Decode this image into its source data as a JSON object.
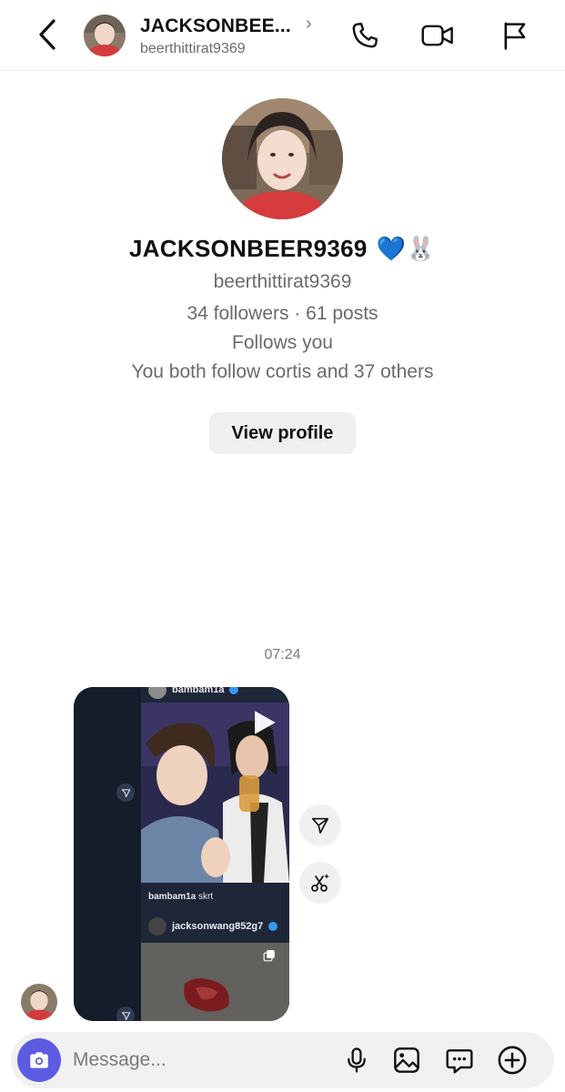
{
  "header": {
    "display_name": "JACKSONBEE...",
    "username": "beerthittirat9369",
    "icons": [
      "back-icon",
      "phone-icon",
      "video-icon",
      "flag-icon"
    ]
  },
  "profile": {
    "name": "JACKSONBEER9369",
    "emoji": "💙🐰",
    "username": "beerthittirat9369",
    "stats": "34 followers · 61 posts",
    "follows_you": "Follows you",
    "mutuals": "You both follow cortis and 37 others",
    "view_profile_label": "View profile"
  },
  "thread": {
    "timestamp": "07:24",
    "shared_post": {
      "post1_user": "bambam1a",
      "post1_caption_user": "bambam1a",
      "post1_caption_text": "skrt",
      "post2_user": "jacksonwang852g7"
    }
  },
  "composer": {
    "placeholder": "Message...",
    "icons": [
      "camera-icon",
      "microphone-icon",
      "gallery-icon",
      "sticker-icon",
      "plus-icon"
    ]
  },
  "colors": {
    "accent": "#5b5ce2",
    "verified": "#3897f0",
    "muted_text": "#6b6b6b"
  }
}
